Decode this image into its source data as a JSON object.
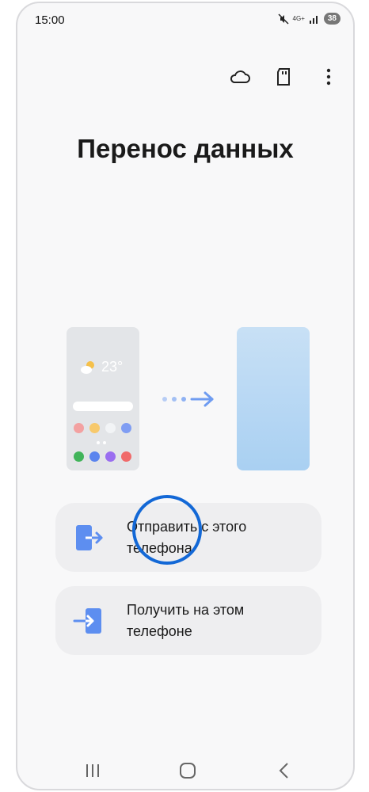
{
  "status": {
    "time": "15:00",
    "network": "4G+",
    "battery": "38"
  },
  "toolbar": {
    "icons": [
      "cloud-icon",
      "sd-card-icon",
      "more-options-icon"
    ]
  },
  "title": "Перенос данных",
  "illustration": {
    "temperature": "23°"
  },
  "actions": [
    {
      "label": "Отправить с этого телефона",
      "icon": "send-from-phone-icon"
    },
    {
      "label": "Получить на этом телефоне",
      "icon": "receive-on-phone-icon"
    }
  ],
  "colors": {
    "accent": "#1368d6",
    "card": "#eeeef0",
    "icon_blue": "#5d8ef0"
  }
}
